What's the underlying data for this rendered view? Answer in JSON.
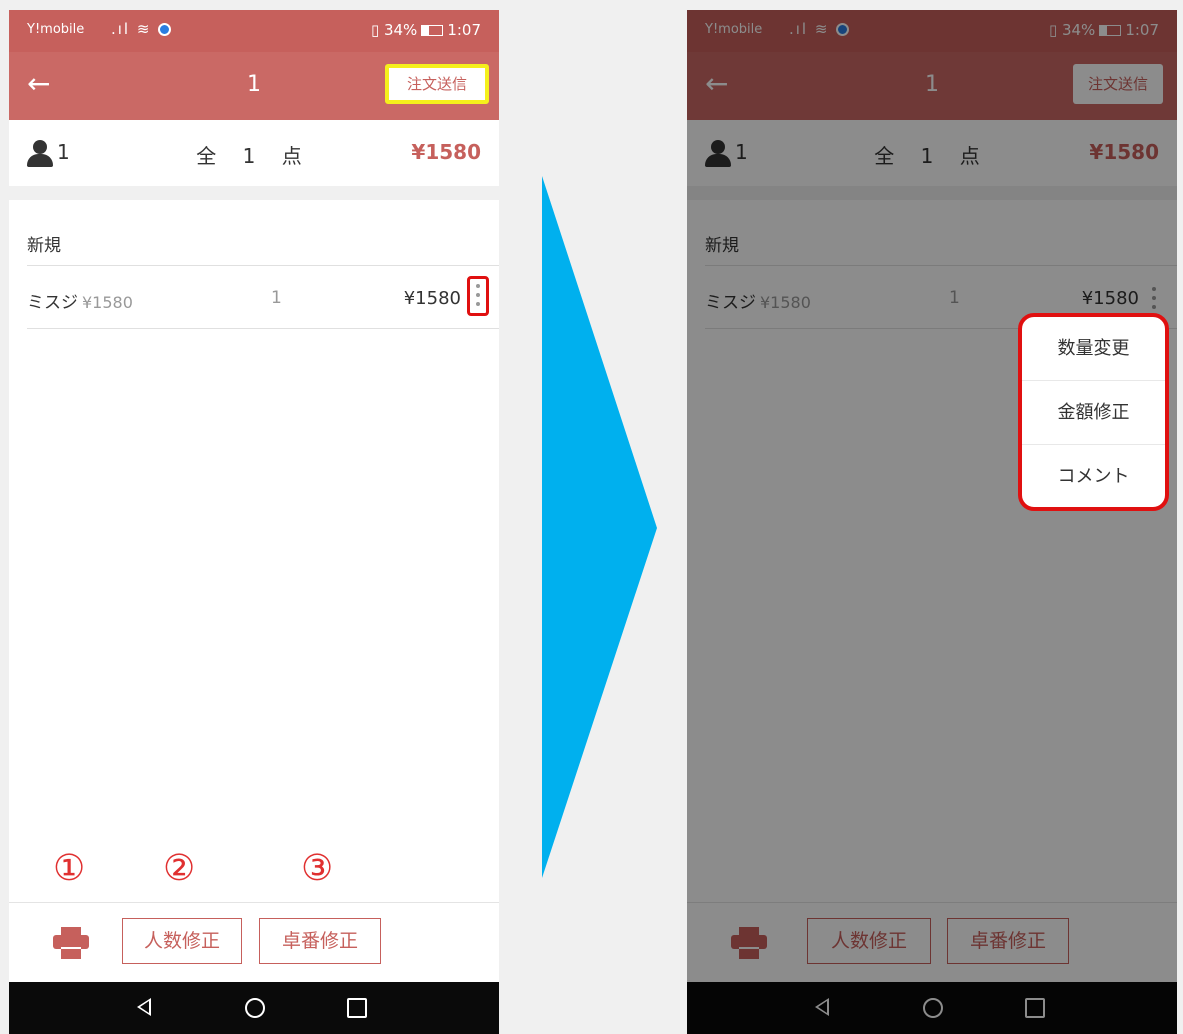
{
  "status_bar": {
    "carrier": "Y!mobile",
    "battery": "34%",
    "time": "1:07"
  },
  "header": {
    "title": "1",
    "send_button": "注文送信"
  },
  "summary": {
    "guests": "1",
    "item_count": "全 1 点",
    "total": "¥1580"
  },
  "section": {
    "label": "新規"
  },
  "order_items": [
    {
      "name": "ミスジ",
      "unit_price": "¥1580",
      "quantity": "1",
      "price": "¥1580"
    }
  ],
  "footer": {
    "guests_button": "人数修正",
    "table_button": "卓番修正"
  },
  "annotations": {
    "n1": "①",
    "n2": "②",
    "n3": "③"
  },
  "popup_menu": {
    "items": [
      "数量変更",
      "金額修正",
      "コメント"
    ]
  },
  "colors": {
    "accent": "#c6605c",
    "header_bg": "#ca6965",
    "highlight_yellow": "#f5f01c",
    "highlight_red": "#e01010",
    "arrow": "#00b0ee"
  }
}
